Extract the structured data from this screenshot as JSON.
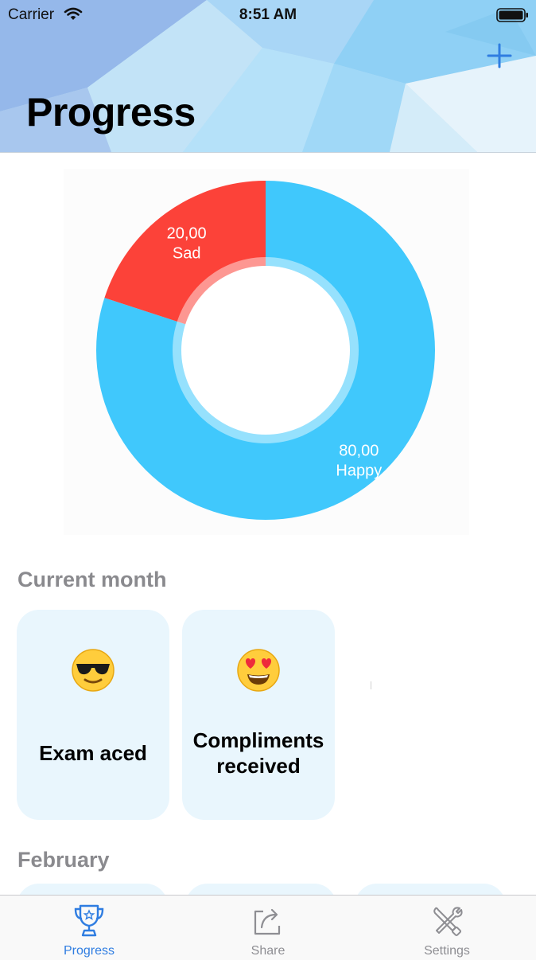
{
  "status_bar": {
    "carrier": "Carrier",
    "time": "8:51 AM",
    "wifi_icon": "wifi-icon",
    "battery_icon": "battery-icon"
  },
  "header": {
    "title": "Progress",
    "add_icon": "plus-icon"
  },
  "colors": {
    "accent": "#2f7de1",
    "happy": "#40c8fc",
    "sad": "#fc4239",
    "card_bg": "#e9f6fd",
    "section_title": "#8a8a8e",
    "tab_inactive": "#8e8e93"
  },
  "chart_data": {
    "type": "pie",
    "categories": [
      "Happy",
      "Sad"
    ],
    "values": [
      80,
      20
    ],
    "value_labels": [
      "80,00",
      "20,00"
    ],
    "colors": [
      "#40c8fc",
      "#fc4239"
    ],
    "hole": true
  },
  "sections": [
    {
      "title": "Current month",
      "cards": [
        {
          "emoji": "😎",
          "title": "Exam aced"
        },
        {
          "emoji": "😍",
          "title": "Compliments received"
        }
      ]
    },
    {
      "title": "February"
    }
  ],
  "tab_bar": {
    "items": [
      {
        "label": "Progress",
        "icon": "trophy-icon",
        "active": true
      },
      {
        "label": "Share",
        "icon": "share-icon",
        "active": false
      },
      {
        "label": "Settings",
        "icon": "tools-icon",
        "active": false
      }
    ]
  }
}
